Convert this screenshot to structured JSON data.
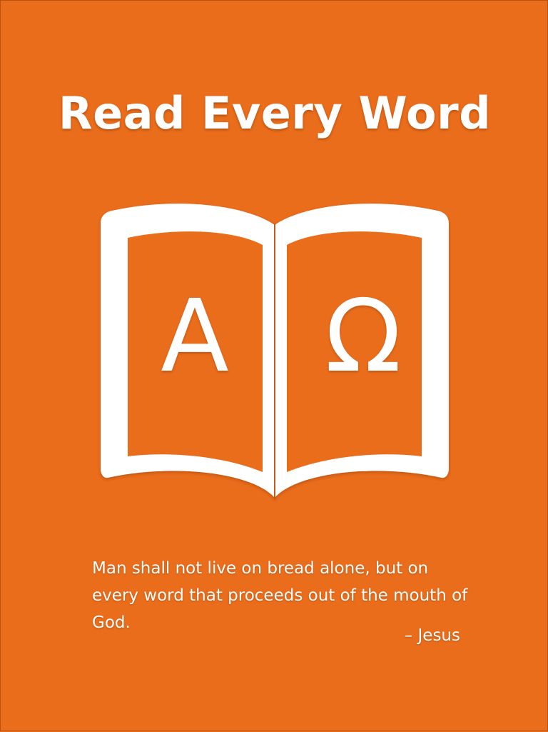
{
  "screen": {
    "background_color": "#ea6d1b",
    "title": "Read Every Word"
  },
  "book": {
    "icon": "open-book-icon",
    "left_page_letter": "A",
    "right_page_letter": "Ω",
    "color": "#ffffff"
  },
  "quote": {
    "text": "Man shall not live on bread alone, but on every word that proceeds out of the mouth of God.",
    "attribution": "– Jesus"
  }
}
